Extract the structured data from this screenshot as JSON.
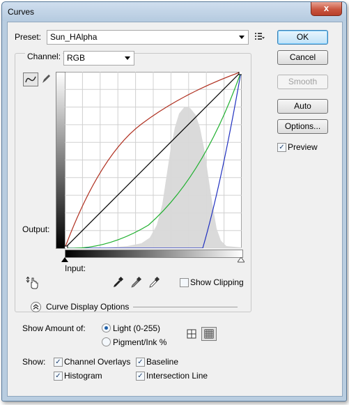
{
  "window": {
    "title": "Curves",
    "close_glyph": "x"
  },
  "preset": {
    "label": "Preset:",
    "value": "Sun_HAlpha"
  },
  "channel": {
    "label": "Channel:",
    "value": "RGB"
  },
  "buttons": {
    "ok": "OK",
    "cancel": "Cancel",
    "smooth": "Smooth",
    "auto": "Auto",
    "options": "Options..."
  },
  "preview": {
    "label": "Preview",
    "checked": true
  },
  "graph": {
    "output_label": "Output:",
    "input_label": "Input:"
  },
  "show_clipping": {
    "label": "Show Clipping",
    "checked": false
  },
  "curve_display": {
    "label": "Curve Display Options"
  },
  "show_amount": {
    "label": "Show Amount of:",
    "light_label": "Light  (0-255)",
    "pigment_label": "Pigment/Ink %",
    "selected": "light"
  },
  "show": {
    "label": "Show:",
    "channel_overlays": "Channel Overlays",
    "baseline": "Baseline",
    "histogram": "Histogram",
    "intersection_line": "Intersection Line"
  },
  "check_glyph": "✓",
  "colors": {
    "red_curve": "#b03020",
    "green_curve": "#20b030",
    "blue_curve": "#2030c0",
    "histogram": "#d8d8d8"
  }
}
